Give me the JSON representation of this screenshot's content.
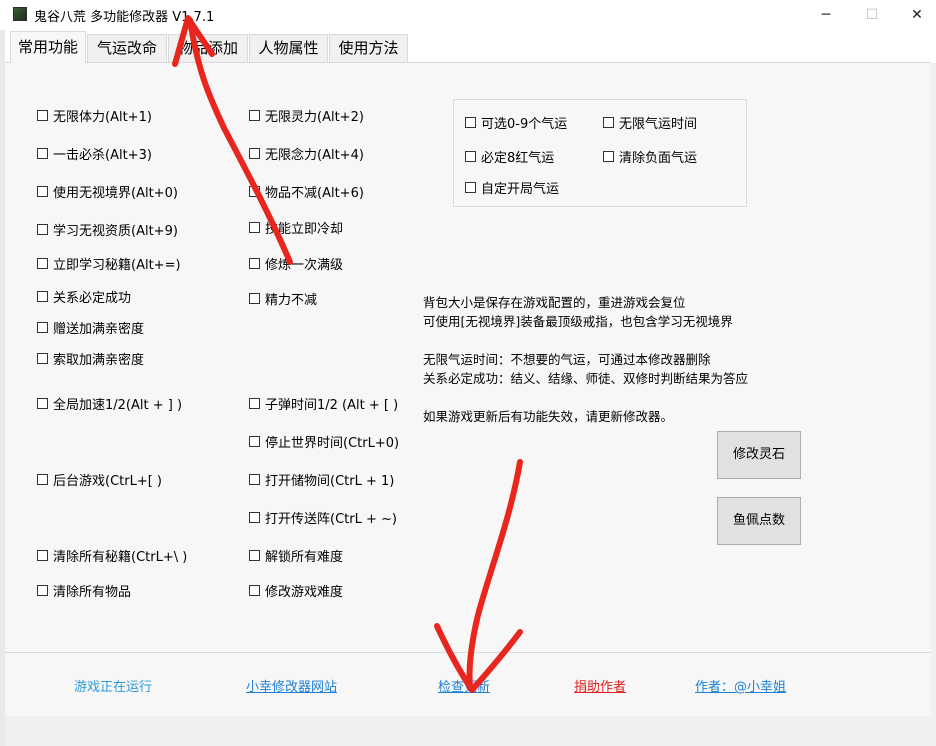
{
  "window": {
    "title": "鬼谷八荒 多功能修改器  V1.7.1",
    "minimize": "─",
    "maximize": "☐",
    "close": "✕"
  },
  "tabs": [
    {
      "label": "常用功能",
      "active": true
    },
    {
      "label": "气运改命",
      "active": false
    },
    {
      "label": "物品添加",
      "active": false
    },
    {
      "label": "人物属性",
      "active": false
    },
    {
      "label": "使用方法",
      "active": false
    }
  ],
  "left_col": [
    "无限体力(Alt+1)",
    "一击必杀(Alt+3)",
    "使用无视境界(Alt+0)",
    "学习无视资质(Alt+9)",
    "立即学习秘籍(Alt+=)",
    "关系必定成功",
    "赠送加满亲密度",
    "索取加满亲密度",
    "全局加速1/2(Alt + ] )",
    "后台游戏(CtrL+[ )",
    "清除所有秘籍(CtrL+\\ )",
    "清除所有物品"
  ],
  "mid_col": [
    "无限灵力(Alt+2)",
    "无限念力(Alt+4)",
    "物品不减(Alt+6)",
    "技能立即冷却",
    "修炼一次满级",
    "精力不减",
    "子弹时间1/2 (Alt + [ )",
    "停止世界时间(CtrL+0)",
    "打开储物间(CtrL + 1)",
    "打开传送阵(CtrL + ~)",
    "解锁所有难度",
    "修改游戏难度"
  ],
  "fortune_group": [
    "可选0-9个气运",
    "无限气运时间",
    "必定8红气运",
    "清除负面气运",
    "自定开局气运"
  ],
  "info_lines": [
    "背包大小是保存在游戏配置的，重进游戏会复位",
    "可使用[无视境界]装备最顶级戒指，也包含学习无视境界",
    "无限气运时间：不想要的气运，可通过本修改器删除",
    "关系必定成功：结义、结缘、师徒、双修时判断结果为答应",
    "如果游戏更新后有功能失效，请更新修改器。"
  ],
  "buttons": {
    "spirit_stone": "修改灵石",
    "fish_pendant": "鱼佩点数"
  },
  "footer": {
    "status": "游戏正在运行",
    "website": "小幸修改器网站",
    "check_update": "检查更新",
    "donate": "捐助作者",
    "author": "作者：@小幸姐"
  },
  "colors": {
    "link_blue": "#1d7fd6",
    "status_blue": "#2d9ad8",
    "donate_red": "#e02020",
    "annotation_red": "#e8261e"
  }
}
